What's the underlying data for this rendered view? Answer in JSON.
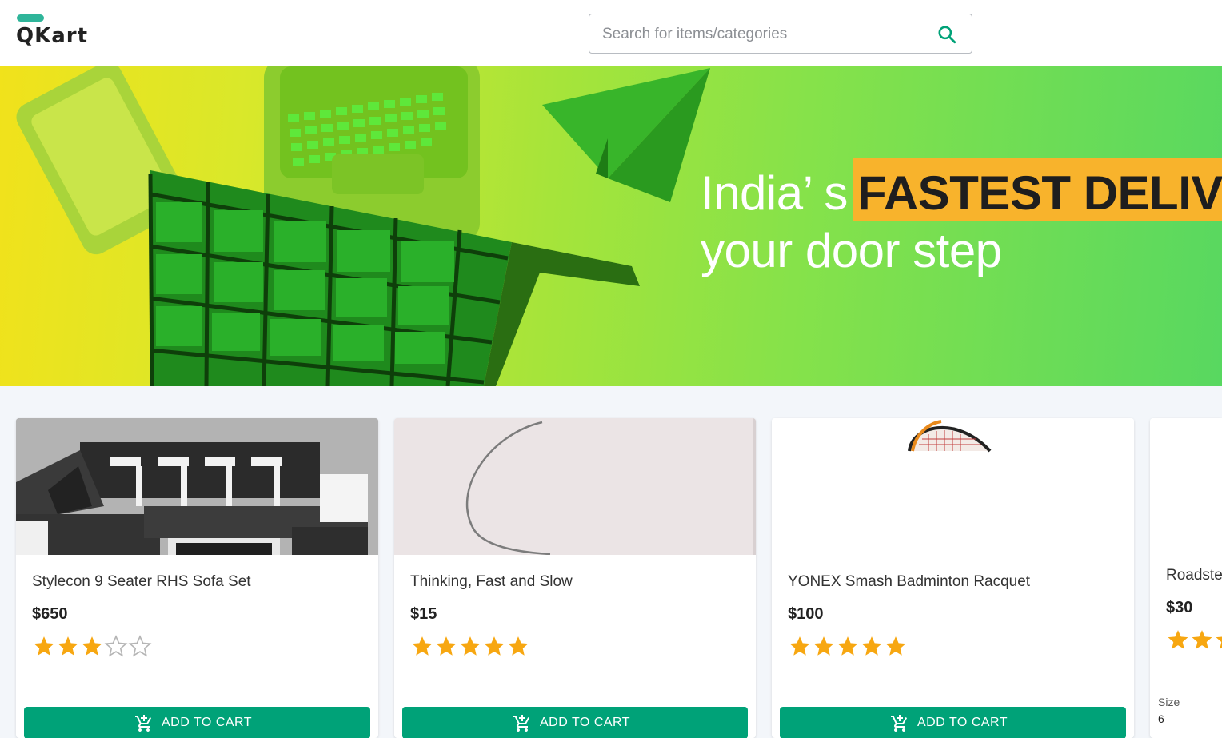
{
  "header": {
    "logo_text": "QKart",
    "search_placeholder": "Search for items/categories"
  },
  "hero": {
    "line1_prefix": "India’ s",
    "line1_highlight": "FASTEST DELIVE",
    "line2": "your door step"
  },
  "products": [
    {
      "name": "Stylecon 9 Seater RHS Sofa Set",
      "price": "$650",
      "rating": 3,
      "button_label": "ADD TO CART"
    },
    {
      "name": "Thinking, Fast and Slow",
      "price": "$15",
      "rating": 5,
      "button_label": "ADD TO CART"
    },
    {
      "name": "YONEX Smash Badminton Racquet",
      "price": "$100",
      "rating": 5,
      "button_label": "ADD TO CART"
    },
    {
      "name": "Roadste",
      "price": "$30",
      "rating": 3,
      "size_label": "Size",
      "size_value": "6"
    }
  ],
  "colors": {
    "accent": "#00a278",
    "logo_bar": "#2fb59a",
    "star": "#f7a711",
    "highlight": "#f8b32c"
  }
}
